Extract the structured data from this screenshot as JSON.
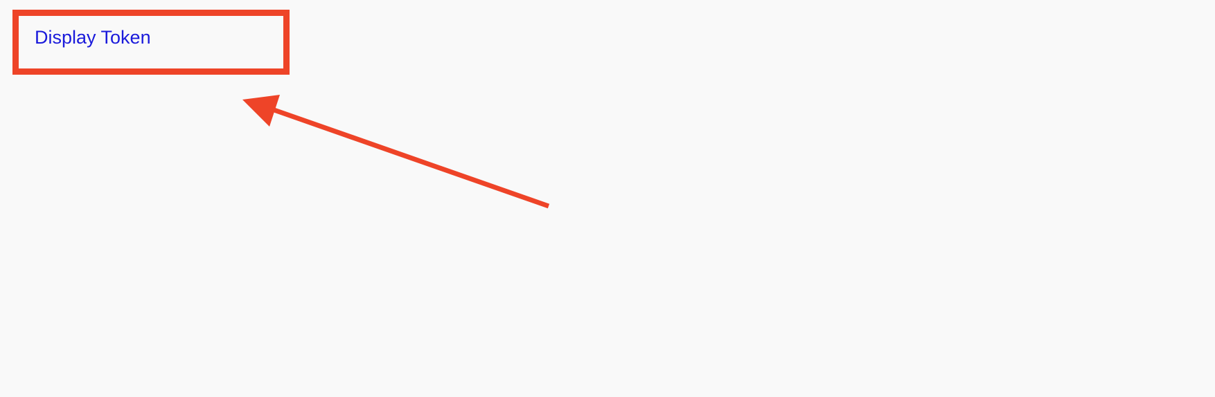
{
  "link": {
    "label": "Display Token"
  },
  "colors": {
    "background": "#f9f9f9",
    "annotation": "#ee4428",
    "link": "#1a1adb"
  }
}
